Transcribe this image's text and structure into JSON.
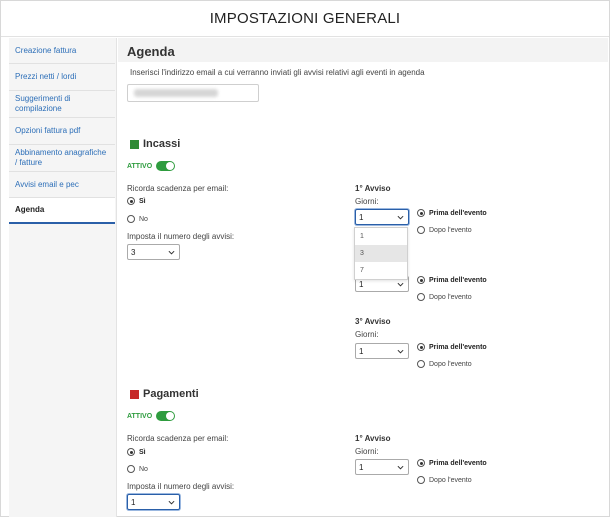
{
  "title": "IMPOSTAZIONI GENERALI",
  "sidebar": {
    "items": [
      {
        "label": "Creazione fattura"
      },
      {
        "label": "Prezzi netti / lordi"
      },
      {
        "label": "Suggerimenti di compilazione"
      },
      {
        "label": "Opzioni fattura pdf"
      },
      {
        "label": "Abbinamento anagrafiche / fatture"
      },
      {
        "label": "Avvisi email e pec"
      },
      {
        "label": "Agenda"
      }
    ]
  },
  "agenda": {
    "heading": "Agenda",
    "intro": "Inserisci l'indirizzo email a cui verranno inviati gli avvisi relativi agli eventi in agenda"
  },
  "incassi": {
    "heading": "Incassi",
    "color": "#2e8b34",
    "attivo": "ATTIVO",
    "ricorda_label": "Ricorda scadenza per email:",
    "si": "Sì",
    "no": "No",
    "numero_label": "Imposta il numero degli avvisi:",
    "numero_value": "3",
    "avviso1_title": "1° Avviso",
    "giorni_label": "Giorni:",
    "avviso1_giorni": "1",
    "dropdown_options": [
      "1",
      "3",
      "7"
    ],
    "avviso2_giorni": "1",
    "avviso3_title": "3° Avviso",
    "avviso3_giorni": "1",
    "prima": "Prima dell'evento",
    "dopo": "Dopo l'evento"
  },
  "pagamenti": {
    "heading": "Pagamenti",
    "color": "#c62828",
    "attivo": "ATTIVO",
    "ricorda_label": "Ricorda scadenza per email:",
    "si": "Sì",
    "no": "No",
    "numero_label": "Imposta il numero degli avvisi:",
    "numero_value": "1",
    "avviso1_title": "1° Avviso",
    "giorni_label": "Giorni:",
    "avviso1_giorni": "1",
    "prima": "Prima dell'evento",
    "dopo": "Dopo l'evento"
  }
}
